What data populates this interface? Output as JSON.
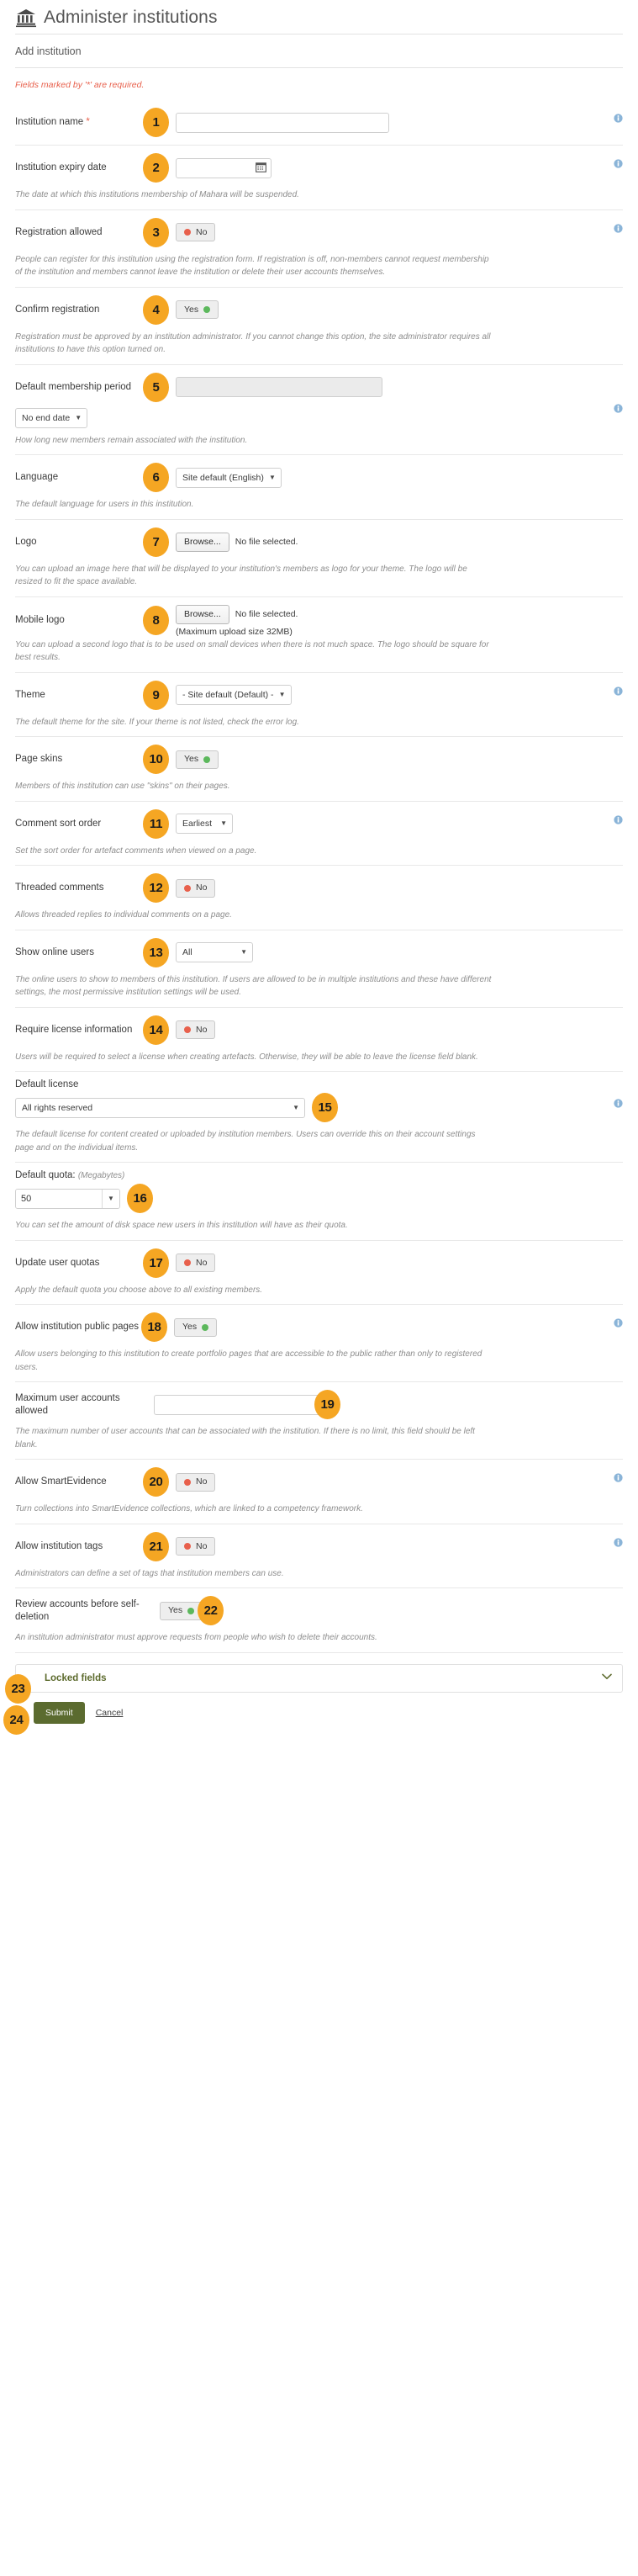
{
  "header": {
    "title": "Administer institutions",
    "icon": "bank-icon"
  },
  "panel": {
    "heading": "Add institution"
  },
  "form": {
    "required_note": "Fields marked by '*' are required.",
    "fields": [
      {
        "badge": "1",
        "label": "Institution name",
        "required_mark": "*",
        "control": "text",
        "value": "",
        "help": "",
        "info": true
      },
      {
        "badge": "2",
        "label": "Institution expiry date",
        "control": "date",
        "value": "",
        "help": "The date at which this institutions membership of Mahara will be suspended.",
        "info": true
      },
      {
        "badge": "3",
        "label": "Registration allowed",
        "control": "switch",
        "value": "No",
        "state": "no",
        "help": "People can register for this institution using the registration form. If registration is off, non-members cannot request membership of the institution and members cannot leave the institution or delete their user accounts themselves.",
        "info": true
      },
      {
        "badge": "4",
        "label": "Confirm registration",
        "control": "switch",
        "value": "Yes",
        "state": "yes",
        "help": "Registration must be approved by an institution administrator. If you cannot change this option, the site administrator requires all institutions to have this option turned on.",
        "info": false
      },
      {
        "badge": "5",
        "label": "Default membership period",
        "control": "period",
        "value": "",
        "select_value": "No end date",
        "help": "How long new members remain associated with the institution.",
        "info": true
      },
      {
        "badge": "6",
        "label": "Language",
        "control": "select",
        "select_value": "Site default (English)",
        "help": "The default language for users in this institution.",
        "info": false
      },
      {
        "badge": "7",
        "label": "Logo",
        "control": "file",
        "browse_label": "Browse...",
        "file_status": "No file selected.",
        "help": "You can upload an image here that will be displayed to your institution's members as logo for your theme. The logo will be resized to fit the space available.",
        "info": false
      },
      {
        "badge": "8",
        "label": "Mobile logo",
        "control": "file",
        "browse_label": "Browse...",
        "file_status": "No file selected.",
        "max_size": "(Maximum upload size 32MB)",
        "help": "You can upload a second logo that is to be used on small devices when there is not much space. The logo should be square for best results.",
        "info": false
      },
      {
        "badge": "9",
        "label": "Theme",
        "control": "select",
        "select_value": "- Site default (Default) -",
        "help": "The default theme for the site. If your theme is not listed, check the error log.",
        "info": true
      },
      {
        "badge": "10",
        "label": "Page skins",
        "control": "switch",
        "value": "Yes",
        "state": "yes",
        "help": "Members of this institution can use \"skins\" on their pages.",
        "info": false
      },
      {
        "badge": "11",
        "label": "Comment sort order",
        "control": "select",
        "select_value": "Earliest",
        "help": "Set the sort order for artefact comments when viewed on a page.",
        "info": true
      },
      {
        "badge": "12",
        "label": "Threaded comments",
        "control": "switch",
        "value": "No",
        "state": "no",
        "help": "Allows threaded replies to individual comments on a page.",
        "info": false
      },
      {
        "badge": "13",
        "label": "Show online users",
        "control": "select",
        "select_value": "All",
        "help": "The online users to show to members of this institution. If users are allowed to be in multiple institutions and these have different settings, the most permissive institution settings will be used.",
        "info": false
      },
      {
        "badge": "14",
        "label": "Require license information",
        "control": "switch",
        "value": "No",
        "state": "no",
        "help": "Users will be required to select a license when creating artefacts. Otherwise, they will be able to leave the license field blank.",
        "info": false
      },
      {
        "badge": "15",
        "label": "Default license",
        "control": "select-stacked",
        "select_value": "All rights reserved",
        "help": "The default license for content created or uploaded by institution members. Users can override this on their account settings page and on the individual items.",
        "info": true
      },
      {
        "badge": "16",
        "label": "Default quota:",
        "unit": "(Megabytes)",
        "control": "quota",
        "value": "50",
        "help": "You can set the amount of disk space new users in this institution will have as their quota.",
        "info": false
      },
      {
        "badge": "17",
        "label": "Update user quotas",
        "control": "switch",
        "value": "No",
        "state": "no",
        "help": "Apply the default quota you choose above to all existing members.",
        "info": false
      },
      {
        "badge": "18",
        "label": "Allow institution public pages",
        "control": "switch",
        "value": "Yes",
        "state": "yes",
        "help": "Allow users belonging to this institution to create portfolio pages that are accessible to the public rather than only to registered users.",
        "info": true
      },
      {
        "badge": "19",
        "label": "Maximum user accounts allowed",
        "control": "text-max",
        "value": "",
        "help": "The maximum number of user accounts that can be associated with the institution. If there is no limit, this field should be left blank.",
        "info": false
      },
      {
        "badge": "20",
        "label": "Allow SmartEvidence",
        "control": "switch",
        "value": "No",
        "state": "no",
        "help": "Turn collections into SmartEvidence collections, which are linked to a competency framework.",
        "info": true
      },
      {
        "badge": "21",
        "label": "Allow institution tags",
        "control": "switch",
        "value": "No",
        "state": "no",
        "help": "Administrators can define a set of tags that institution members can use.",
        "info": true
      },
      {
        "badge": "22",
        "label": "Review accounts before self-deletion",
        "control": "switch",
        "value": "Yes",
        "state": "yes",
        "help": "An institution administrator must approve requests from people who wish to delete their accounts.",
        "info": false
      }
    ],
    "locked_fields": {
      "badge": "23",
      "title": "Locked fields",
      "chevron_icon": "chevron-down-icon"
    },
    "actions": {
      "badge": "24",
      "submit_label": "Submit",
      "cancel_label": "Cancel"
    }
  },
  "colors": {
    "badge_bg": "#f5a623",
    "submit_bg": "#5b6b2f",
    "required_text": "#e8604c",
    "switch_yes_dot": "#5cb85c",
    "switch_no_dot": "#e8604c",
    "locked_title": "#5c6a2c"
  }
}
